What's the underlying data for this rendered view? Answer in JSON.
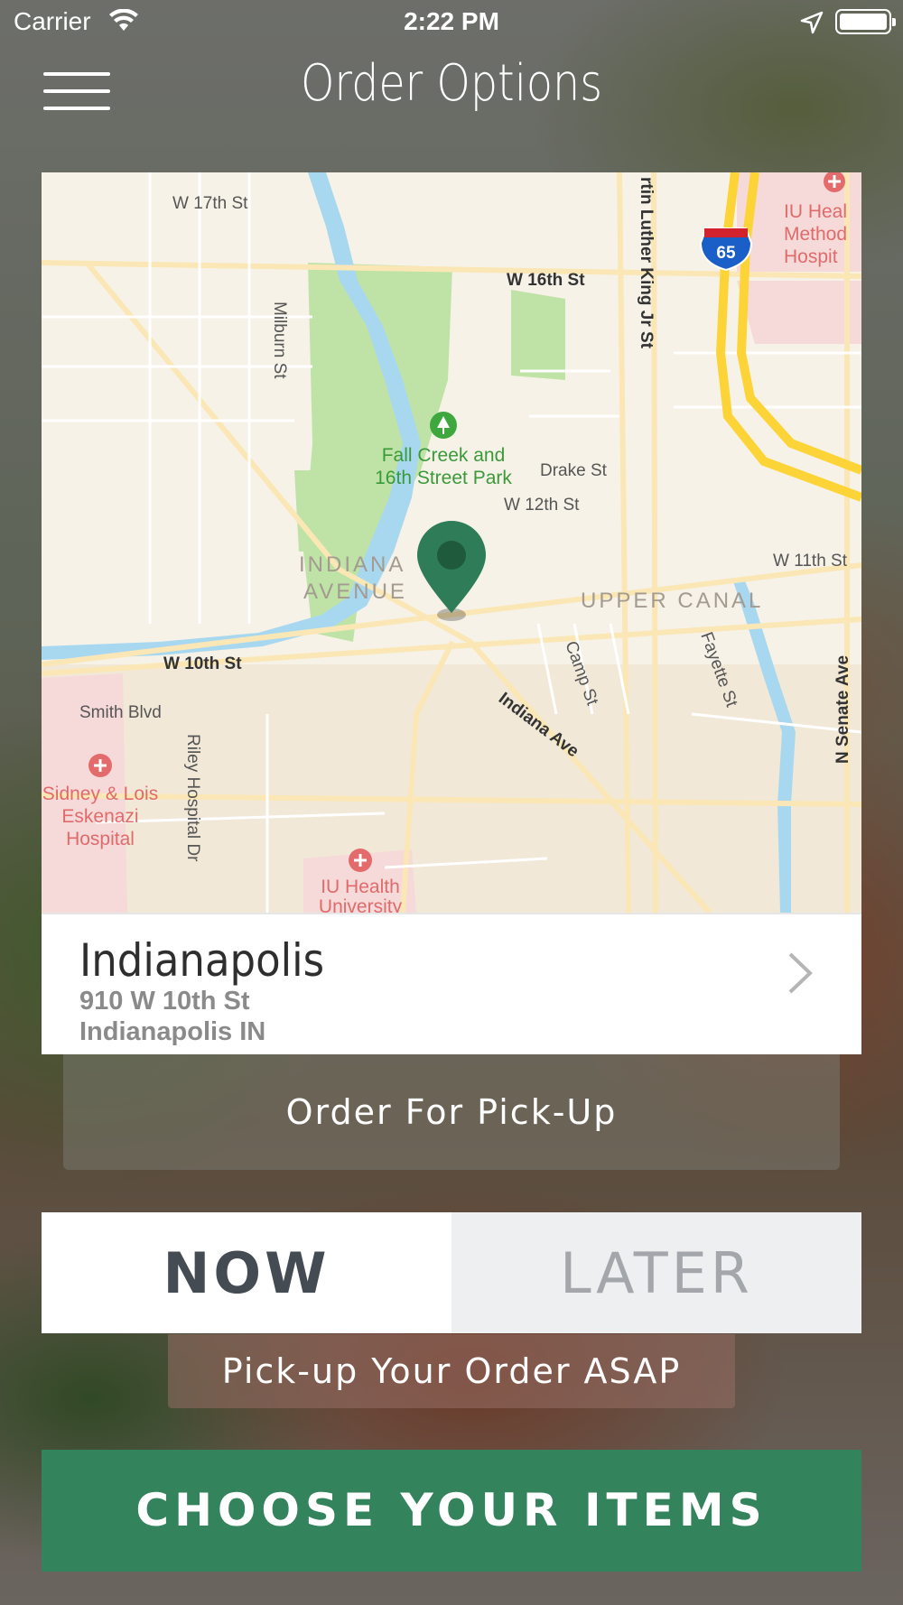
{
  "status_bar": {
    "carrier": "Carrier",
    "time": "2:22 PM"
  },
  "header": {
    "title": "Order Options",
    "menu_icon": "hamburger-menu-icon"
  },
  "map": {
    "labels": {
      "w17": "W 17th St",
      "w16": "W 16th St",
      "milburn": "Milburn St",
      "mlk": "rtin Luther King Jr St",
      "i65": "65",
      "iu_methodist_1": "IU Heal",
      "iu_methodist_2": "Method",
      "iu_methodist_3": "Hospit",
      "park_1": "Fall Creek and",
      "park_2": "16th Street Park",
      "drake": "Drake St",
      "w12": "W 12th St",
      "w11": "W 11th St",
      "indiana_ave_1": "INDIANA",
      "indiana_ave_2": "AVENUE",
      "upper_canal": "UPPER CANAL",
      "w10": "W 10th St",
      "smith": "Smith Blvd",
      "camp": "Camp St",
      "fayette": "Fayette St",
      "senate": "N Senate Ave",
      "indiana_ave_road": "Indiana Ave",
      "riley": "Riley Hospital Dr",
      "eskenazi_1": "Sidney & Lois",
      "eskenazi_2": "Eskenazi",
      "eskenazi_3": "Hospital",
      "iu_university_1": "IU Health",
      "iu_university_2": "University"
    },
    "pin_color": "#2f7d58"
  },
  "location": {
    "name": "Indianapolis",
    "address_line1": "910 W 10th St",
    "address_line2": "Indianapolis IN"
  },
  "order_type": "Order For Pick-Up",
  "toggle": {
    "now": "NOW",
    "later": "LATER",
    "selected": "NOW"
  },
  "pickup_note": "Pick-up Your Order ASAP",
  "cta": {
    "label": "CHOOSE YOUR ITEMS",
    "color": "#33835c"
  }
}
